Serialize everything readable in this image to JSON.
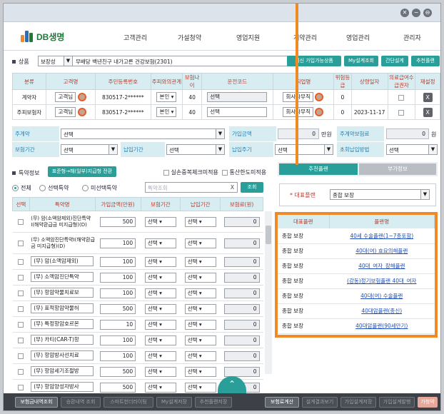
{
  "nav": {
    "brand": "DB생명",
    "menu": [
      "고객관리",
      "가설청약",
      "영업지원",
      "계약관리",
      "영업관리",
      "관리자"
    ]
  },
  "product_bar": {
    "label": "상품",
    "type_value": "보장성",
    "product_value": "무배당 백년친구 내가고른 건강보험(2301)",
    "buttons": [
      "최신 가입가능상품",
      "My설계조회",
      "간단설계",
      "추천플랜"
    ]
  },
  "insured_table": {
    "headers": [
      "분류",
      "고객명",
      "주민등록번호",
      "주피와의관계",
      "보험나이",
      "운전코드",
      "직업명",
      "위험등급",
      "상령일자",
      "의료급여수급권자",
      "재설정"
    ],
    "rows": [
      {
        "type": "계약자",
        "name": "고객님",
        "rrn": "830517-2******",
        "relation": "본인",
        "age": "40",
        "drive": "선택",
        "job": "회사사무직",
        "risk": "0",
        "date": "",
        "x": "X"
      },
      {
        "type": "주피보험자",
        "name": "고객님",
        "rrn": "830517-2******",
        "relation": "본인",
        "age": "40",
        "drive": "선택",
        "job": "회사사무직",
        "risk": "0",
        "date": "2023-11-17",
        "x": "X"
      }
    ]
  },
  "plan_form": {
    "row1": {
      "main_contract": "주계약",
      "main_value": "선택",
      "sub_amount": "가입금액",
      "amount_unit": "만원",
      "amount_value": "0",
      "premium_label": "주계약보험료",
      "premium_value": "0",
      "premium_unit": "원"
    },
    "row2": {
      "period_label": "보험기간",
      "period_value": "선택",
      "pay_period_label": "납입기간",
      "pay_period_value": "선택",
      "pay_cycle_label": "납입주기",
      "pay_cycle_value": "선택",
      "first_pay_label": "초회납입방법",
      "first_pay_value": "선택"
    }
  },
  "rider_section": {
    "title": "특약정보",
    "convert_button": "표준형→해(일부)지급형 전환",
    "check1": "실손중복체크미적용",
    "check2": "통산한도미적용",
    "filters": [
      "전체",
      "선택특약",
      "미선택특약"
    ],
    "search_placeholder": "특약조회",
    "search_clear": "X",
    "search_button": "조회",
    "headers": [
      "선택",
      "특약명",
      "가입금액(만원)",
      "보험기간",
      "납입기간",
      "보험료(원)"
    ],
    "rows": [
      {
        "name": "(무) 암(소액암제외)진단특약Ⅰ(해약환급금 미지급형)(D)",
        "amount": "500",
        "period": "선택",
        "pay": "선택",
        "premium": "0"
      },
      {
        "name": "(무) 소액암진단특약Ⅰ(해약환급금 미지급형)(D)",
        "amount": "100",
        "period": "선택",
        "pay": "선택",
        "premium": "0"
      },
      {
        "name": "(무) 암(소액암제외)",
        "amount": "100",
        "period": "선택",
        "pay": "선택",
        "premium": "0"
      },
      {
        "name": "(무) 소액암진단특약",
        "amount": "100",
        "period": "선택",
        "pay": "선택",
        "premium": "0"
      },
      {
        "name": "(무) 항암약물치료보",
        "amount": "100",
        "period": "선택",
        "pay": "선택",
        "premium": "0"
      },
      {
        "name": "(무) 표적항암약물허",
        "amount": "500",
        "period": "선택",
        "pay": "선택",
        "premium": "0"
      },
      {
        "name": "(무) 특정항암호르몬",
        "amount": "10",
        "period": "선택",
        "pay": "선택",
        "premium": "0"
      },
      {
        "name": "(무) 카티(CAR-T)항",
        "amount": "100",
        "period": "선택",
        "pay": "선택",
        "premium": "0"
      },
      {
        "name": "(무) 항암방사선치료",
        "amount": "100",
        "period": "선택",
        "pay": "선택",
        "premium": "0"
      },
      {
        "name": "(무) 항암세기조절방",
        "amount": "500",
        "period": "선택",
        "pay": "선택",
        "premium": "0"
      },
      {
        "name": "(무) 항암양성자방사",
        "amount": "500",
        "period": "선택",
        "pay": "선택",
        "premium": "0"
      }
    ]
  },
  "right_panel": {
    "tab_active": "추천플랜",
    "tab_inactive": "부가정보",
    "rep_plan_label": "대표플랜",
    "rep_plan_value": "종합 보장",
    "table_headers": [
      "대표플랜",
      "플랜명"
    ],
    "rows": [
      {
        "rep": "종합 보장",
        "name": "40세 수술플랜(1~7종포함)"
      },
      {
        "rep": "종합 보장",
        "name": "40대(여) 효요의해플랜"
      },
      {
        "rep": "종합 보장",
        "name": "40대_여자_장해플랜"
      },
      {
        "rep": "종합 보장",
        "name": "(강동)정기보험플랜 40대_여자"
      },
      {
        "rep": "종합 보장",
        "name": "40대(여) 수술플랜"
      },
      {
        "rep": "종합 보장",
        "name": "40대암플랜(종신)"
      },
      {
        "rep": "종합 보장",
        "name": "40대암플랜(90세만기)"
      }
    ]
  },
  "bottom_bar": {
    "left": [
      "보험금내역조회",
      "승환내역 조회",
      "스마트헌더라이팅",
      "My설계저장",
      "추천플랜저장"
    ],
    "right": [
      "보험료계산",
      "설계결과보기",
      "가입설계저장",
      "가입설계발행",
      "가청약"
    ]
  },
  "icons": {
    "close": "close-icon",
    "minimize": "minimize-icon",
    "settings": "gear-icon"
  },
  "colors": {
    "accent": "#2a9f99",
    "highlight": "#f08a24",
    "brand_green": "#1e7a3a"
  }
}
